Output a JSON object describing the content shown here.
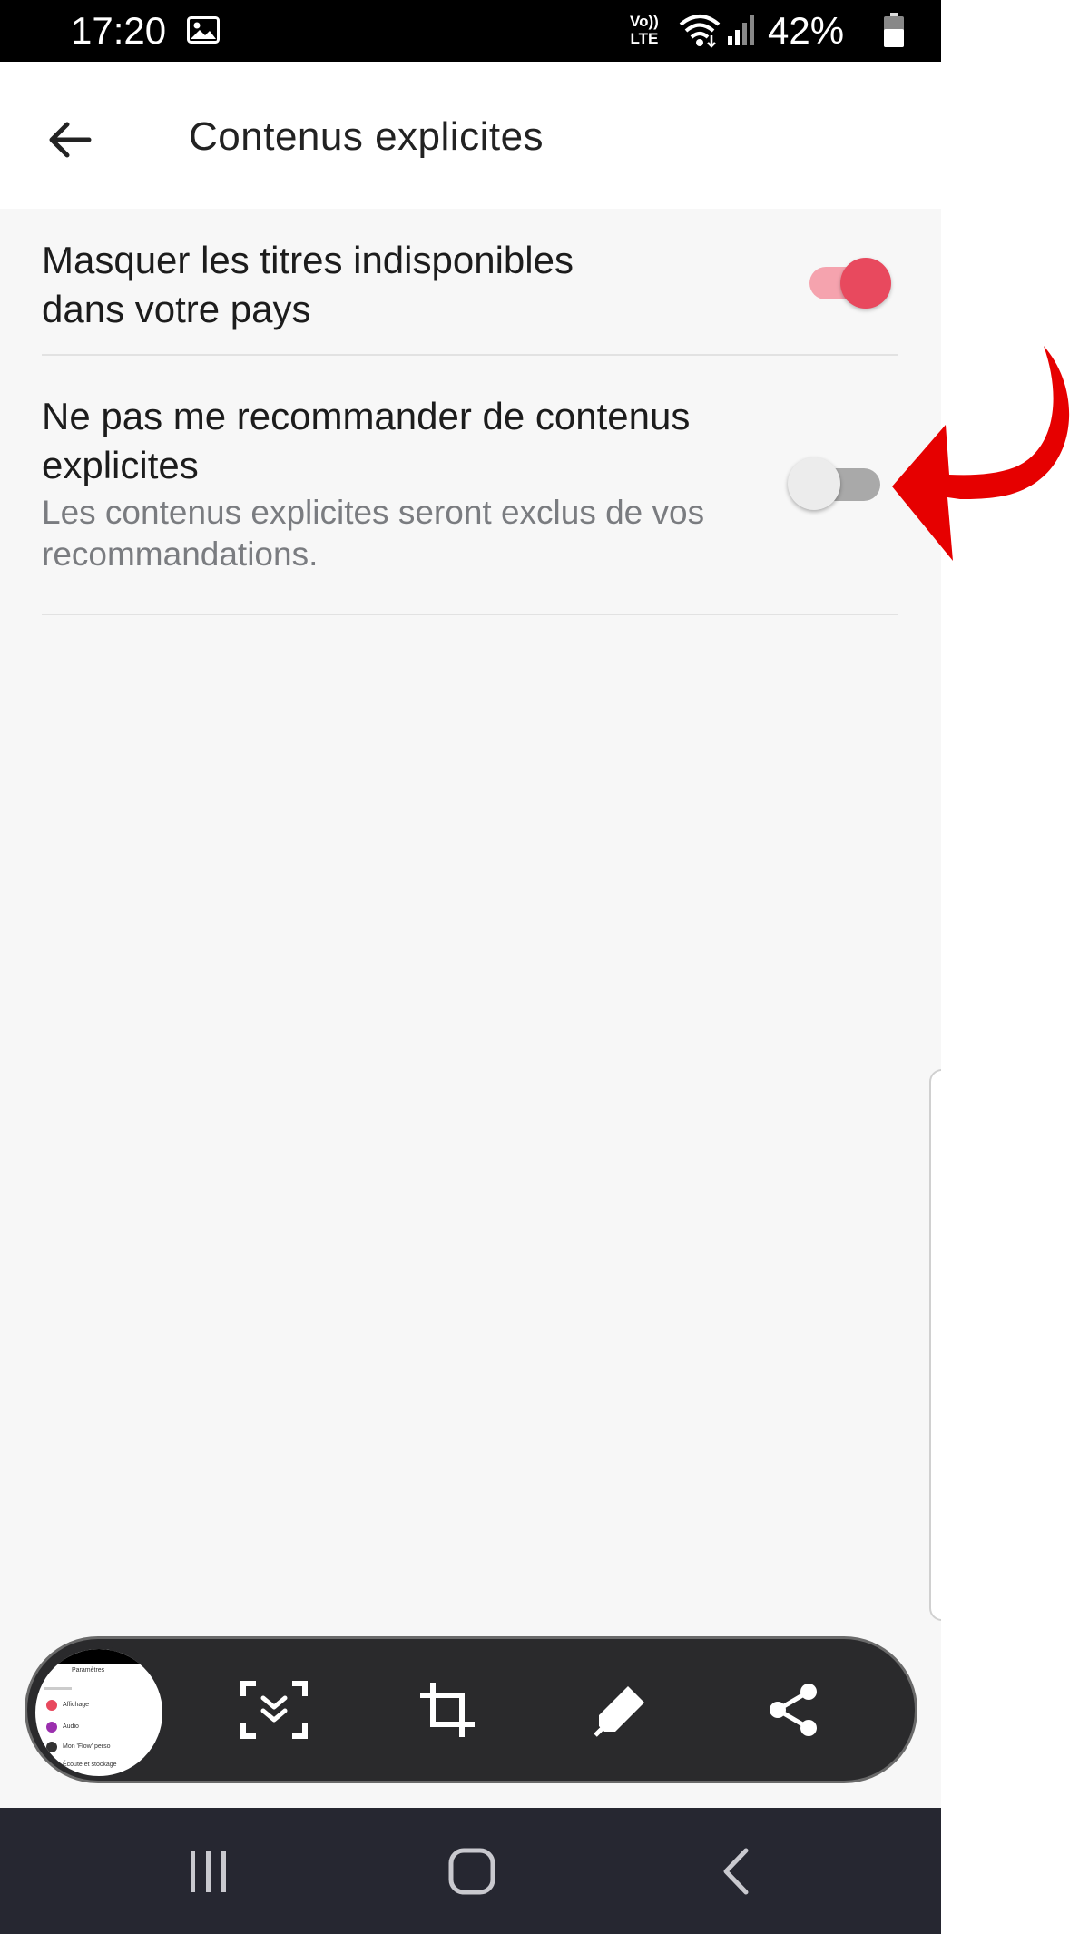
{
  "status_bar": {
    "time": "17:20",
    "network_label_top": "Vo))",
    "network_label_bottom": "LTE",
    "battery": "42%",
    "icons": [
      "gallery-icon",
      "volte-icon",
      "wifi-icon",
      "signal-icon",
      "battery-icon"
    ]
  },
  "app_bar": {
    "title": "Contenus explicites",
    "back_icon": "arrow-left-icon"
  },
  "settings": [
    {
      "title": "Masquer les titres indisponibles dans votre pays",
      "title_line1": "Masquer les titres indisponibles",
      "title_line2": "dans votre pays",
      "enabled": true
    },
    {
      "title_line1": "Ne pas me recommander de contenus",
      "title_line2": "explicites",
      "description_line1": "Les contenus explicites seront exclus de vos",
      "description_line2": "recommandations.",
      "enabled": false
    }
  ],
  "capture_toolbar": {
    "tools": [
      "scroll-capture-icon",
      "crop-icon",
      "edit-pen-icon",
      "share-icon"
    ],
    "preview_texts": [
      "Paramètres",
      "Affichage",
      "Audio",
      "Mon 'Flow' perso",
      "Écoute et stockage"
    ]
  },
  "nav_bar": {
    "buttons": [
      "recent-apps-icon",
      "home-icon",
      "back-icon"
    ]
  },
  "colors": {
    "accent": "#e8495e",
    "accent_track": "#f5a3ae",
    "annotation_arrow": "#e60000",
    "nav_bar": "#262731",
    "capture_bar": "#2a2a2c"
  }
}
